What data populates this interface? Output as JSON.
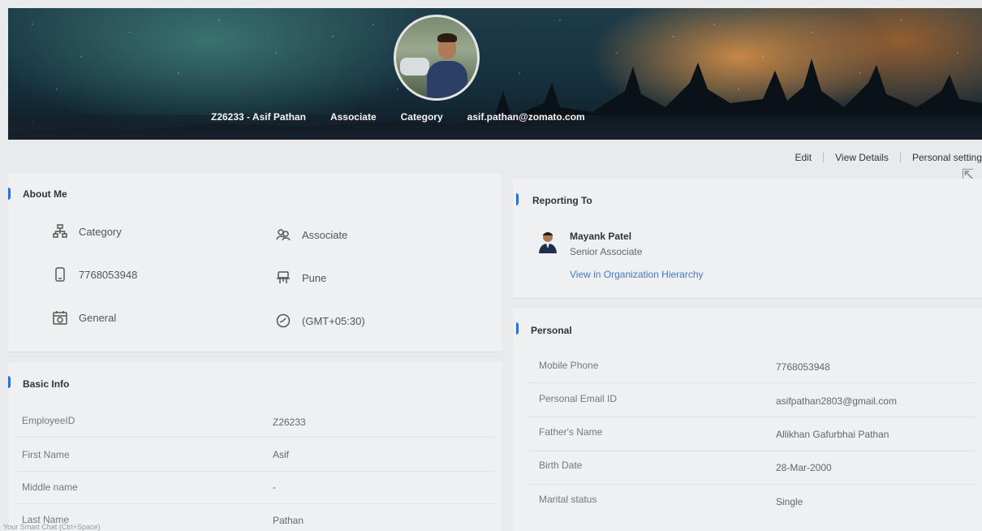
{
  "header": {
    "employee": "Z26233 - Asif Pathan",
    "role": "Associate",
    "category": "Category",
    "email": "asif.pathan@zomato.com"
  },
  "actions": {
    "edit": "Edit",
    "view_details": "View Details",
    "personal_settings": "Personal setting"
  },
  "about": {
    "title": "About Me",
    "items": [
      {
        "icon": "hierarchy-icon",
        "text": "Category"
      },
      {
        "icon": "people-icon",
        "text": "Associate"
      },
      {
        "icon": "mobile-icon",
        "text": "7768053948"
      },
      {
        "icon": "desk-icon",
        "text": "Pune"
      },
      {
        "icon": "calendar-icon",
        "text": "General"
      },
      {
        "icon": "clock-icon",
        "text": "(GMT+05:30)"
      }
    ]
  },
  "basic": {
    "title": "Basic Info",
    "rows": [
      {
        "label": "EmployeeID",
        "value": "Z26233"
      },
      {
        "label": "First Name",
        "value": "Asif"
      },
      {
        "label": "Middle name",
        "value": "-"
      },
      {
        "label": "Last Name",
        "value": "Pathan"
      }
    ]
  },
  "reporting": {
    "title": "Reporting To",
    "name": "Mayank Patel",
    "role": "Senior Associate",
    "link": "View in Organization Hierarchy"
  },
  "personal": {
    "title": "Personal",
    "rows": [
      {
        "label": "Mobile Phone",
        "value": "7768053948"
      },
      {
        "label": "Personal Email ID",
        "value": "asifpathan2803@gmail.com"
      },
      {
        "label": "Father's Name",
        "value": "Allikhan Gafurbhai Pathan"
      },
      {
        "label": "Birth Date",
        "value": "28-Mar-2000"
      },
      {
        "label": "Marital status",
        "value": "Single"
      }
    ]
  },
  "chat": {
    "hint": "Your Smart Chat (Ctrl+Space)"
  }
}
